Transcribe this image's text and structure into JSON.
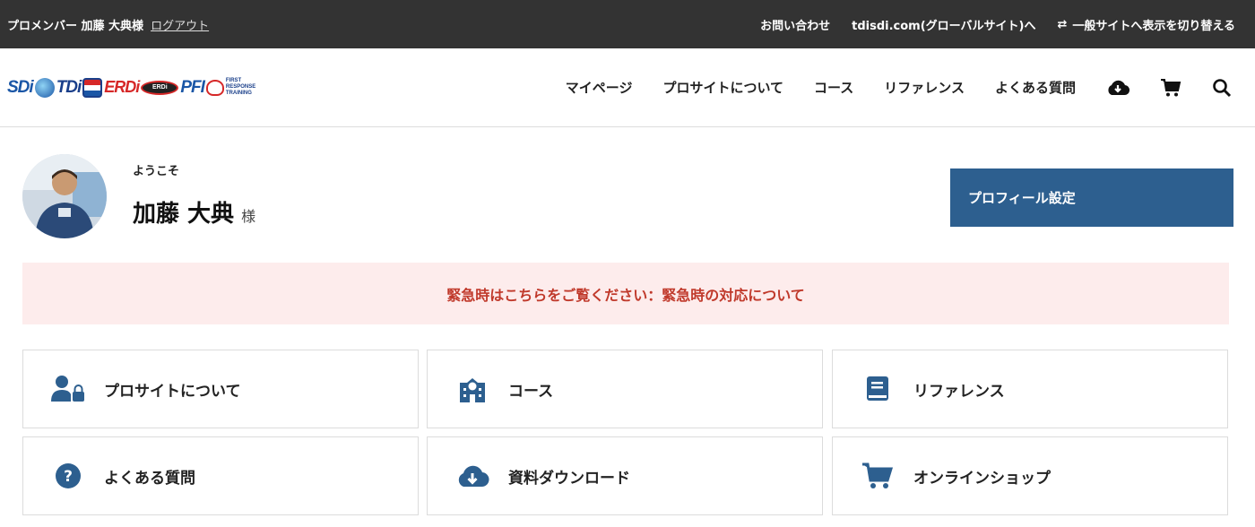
{
  "topbar": {
    "member_label": "プロメンバー 加藤 大典様",
    "logout": "ログアウト",
    "contact": "お問い合わせ",
    "global_site": "tdisdi.com(グローバルサイト)へ",
    "switch_icon": "⇄",
    "switch_site": "一般サイトへ表示を切り替える"
  },
  "header": {
    "logos": {
      "sdi": "SDi",
      "tdi": "TDi",
      "erdi": "ERDi",
      "erdi_oval": "ERDi",
      "pfi": "PFI",
      "first_response": "FIRST RESPONSE TRAINING"
    },
    "nav": [
      "マイページ",
      "プロサイトについて",
      "コース",
      "リファレンス",
      "よくある質問"
    ],
    "icons": [
      "cloud-download-icon",
      "cart-icon",
      "search-icon"
    ]
  },
  "welcome": {
    "greeting": "ようこそ",
    "name": "加藤 大典",
    "honorific": "様",
    "profile_button": "プロフィール設定"
  },
  "alert": {
    "text": "緊急時はこちらをご覧ください：緊急時の対応について",
    "color": "#c0392b",
    "background": "#fdecec"
  },
  "cards": [
    {
      "label": "プロサイトについて",
      "icon": "user-lock-icon"
    },
    {
      "label": "コース",
      "icon": "school-icon"
    },
    {
      "label": "リファレンス",
      "icon": "book-icon"
    },
    {
      "label": "よくある質問",
      "icon": "question-circle-icon"
    },
    {
      "label": "資料ダウンロード",
      "icon": "cloud-download-icon"
    },
    {
      "label": "オンラインショップ",
      "icon": "cart-icon"
    }
  ],
  "colors": {
    "topbar": "#333333",
    "accent": "#2d5f8f",
    "icon": "#2d5f8f"
  }
}
